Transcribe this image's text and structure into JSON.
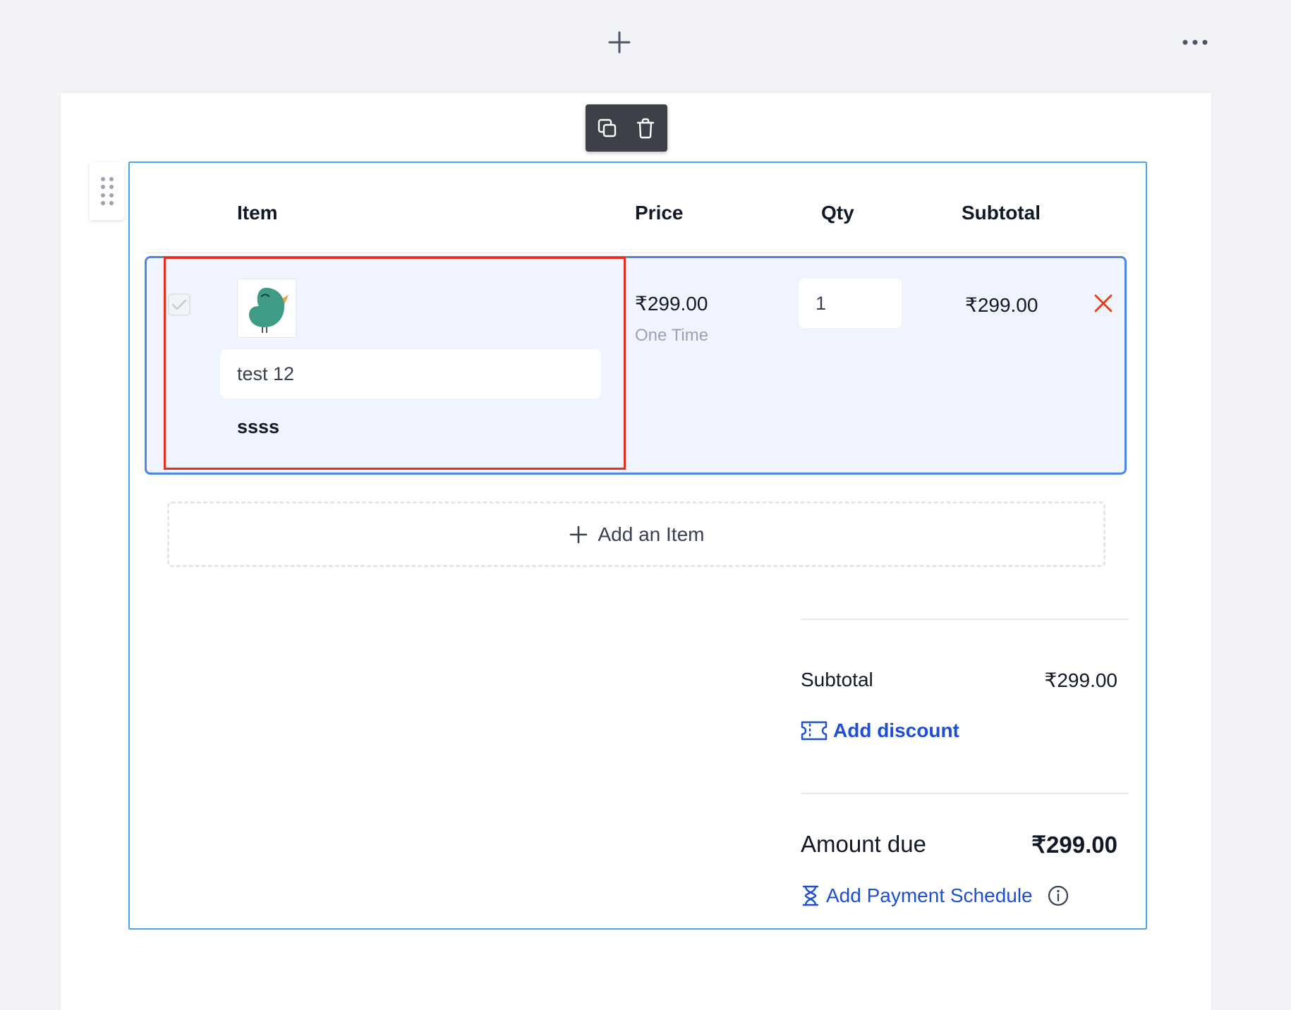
{
  "top_bar": {
    "add_icon": "plus-icon",
    "more_icon": "more-horizontal-icon"
  },
  "toolbar": {
    "duplicate_icon": "duplicate-icon",
    "delete_icon": "trash-icon"
  },
  "drag_handle_icon": "drag-handle-icon",
  "table": {
    "headers": {
      "item": "Item",
      "price": "Price",
      "qty": "Qty",
      "subtotal": "Subtotal"
    },
    "rows": [
      {
        "name": "test 12",
        "description": "ssss",
        "price": "₹299.00",
        "price_type": "One Time",
        "qty": "1",
        "subtotal": "₹299.00",
        "image_icon": "bird-image"
      }
    ]
  },
  "add_item_label": "Add an Item",
  "summary": {
    "subtotal_label": "Subtotal",
    "subtotal_value": "₹299.00",
    "add_discount_label": "Add discount",
    "amount_due_label": "Amount due",
    "amount_due_value": "₹299.00",
    "add_payment_schedule_label": "Add Payment Schedule"
  },
  "colors": {
    "accent_blue": "#1d4ed8",
    "block_border": "#4fa3ee",
    "row_border": "#4f86ec",
    "row_background": "#eff4fe",
    "highlight_red": "#ea2e1e",
    "remove_orange": "#ea3a10",
    "toolbar_bg": "#3d4047",
    "bird_teal": "#3f9a86",
    "bird_beak": "#f0a04b"
  }
}
